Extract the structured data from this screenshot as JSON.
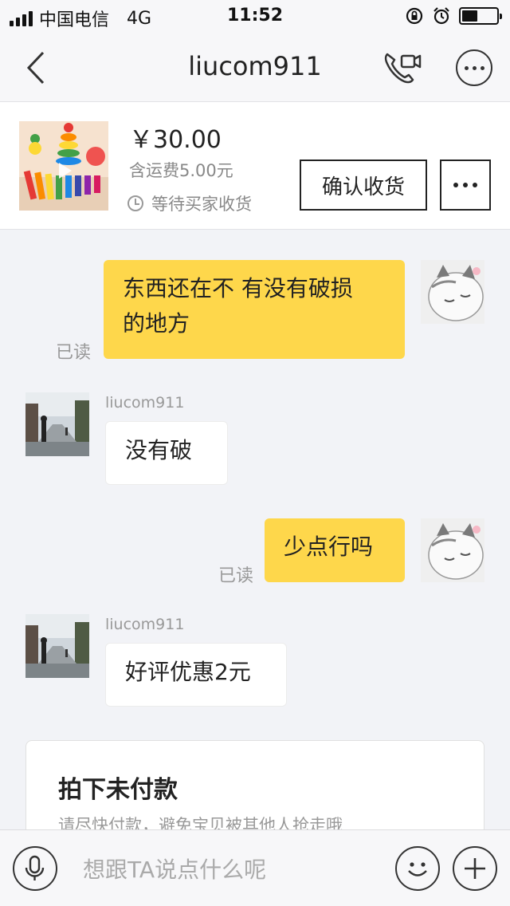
{
  "status_bar": {
    "carrier": "中国电信",
    "network": "4G",
    "time": "11:52"
  },
  "nav": {
    "title": "liucom911"
  },
  "product": {
    "price": "￥30.00",
    "shipping": "含运费5.00元",
    "status": "等待买家收货",
    "confirm_label": "确认收货"
  },
  "messages": [
    {
      "from": "me",
      "text_line1": "东西还在不 有没有破损",
      "text_line2": "的地方",
      "read": "已读"
    },
    {
      "from": "them",
      "sender": "liucom911",
      "text": "没有破"
    },
    {
      "from": "me",
      "text": "少点行吗",
      "read": "已读"
    },
    {
      "from": "them",
      "sender": "liucom911",
      "text": "好评优惠2元"
    }
  ],
  "order_card": {
    "title": "拍下未付款",
    "desc": "请尽快付款，避免宝贝被其他人抢走哦"
  },
  "input": {
    "placeholder": "想跟TA说点什么呢"
  },
  "colors": {
    "my_bubble": "#fed74b",
    "background": "#f2f3f7"
  }
}
